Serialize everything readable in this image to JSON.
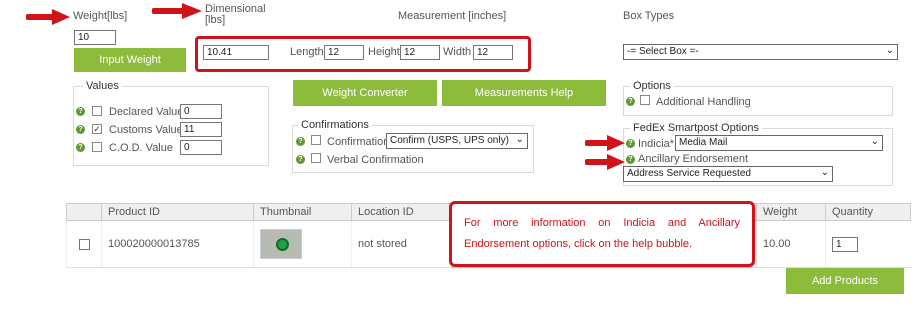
{
  "weight": {
    "label": "Weight[lbs]",
    "value": "10",
    "input_button": "Input Weight"
  },
  "dimensional": {
    "label": "Dimensional [lbs]",
    "value": "10.41"
  },
  "measurement": {
    "label": "Measurement [inches]",
    "length_label": "Length",
    "length": "12",
    "height_label": "Height",
    "height": "12",
    "width_label": "Width",
    "width": "12"
  },
  "box_types": {
    "label": "Box Types",
    "selected": "-= Select Box =-"
  },
  "values": {
    "legend": "Values",
    "declared_label": "Declared Value",
    "declared_value": "0",
    "customs_label": "Customs Value",
    "customs_value": "11",
    "cod_label": "C.O.D. Value",
    "cod_value": "0"
  },
  "buttons": {
    "weight_converter": "Weight Converter",
    "measurements_help": "Measurements Help",
    "add_products": "Add Products"
  },
  "confirmations": {
    "legend": "Confirmations",
    "confirmation_label": "Confirmation",
    "confirmation_selected": "Confirm (USPS, UPS only)",
    "verbal_label": "Verbal Confirmation"
  },
  "options": {
    "legend": "Options",
    "additional_handling": "Additional Handling"
  },
  "smartpost": {
    "legend": "FedEx Smartpost Options",
    "indicia_label": "Indicia*",
    "indicia_selected": "Media Mail",
    "ancillary_label": "Ancillary Endorsement",
    "ancillary_selected": "Address Service Requested"
  },
  "callout": "For more information on Indicia and Ancillary Endorsement options, click on the help bubble.",
  "table": {
    "headers": {
      "product_id": "Product ID",
      "thumbnail": "Thumbnail",
      "location_id": "Location ID",
      "weight": "Weight",
      "quantity": "Quantity"
    },
    "row": {
      "product_id": "100020000013785",
      "location": "not stored",
      "weight": "10.00",
      "quantity": "1"
    }
  },
  "colors": {
    "accent": "#8dbb3c",
    "highlight": "#d0121b",
    "help": "#5c9b2e"
  }
}
